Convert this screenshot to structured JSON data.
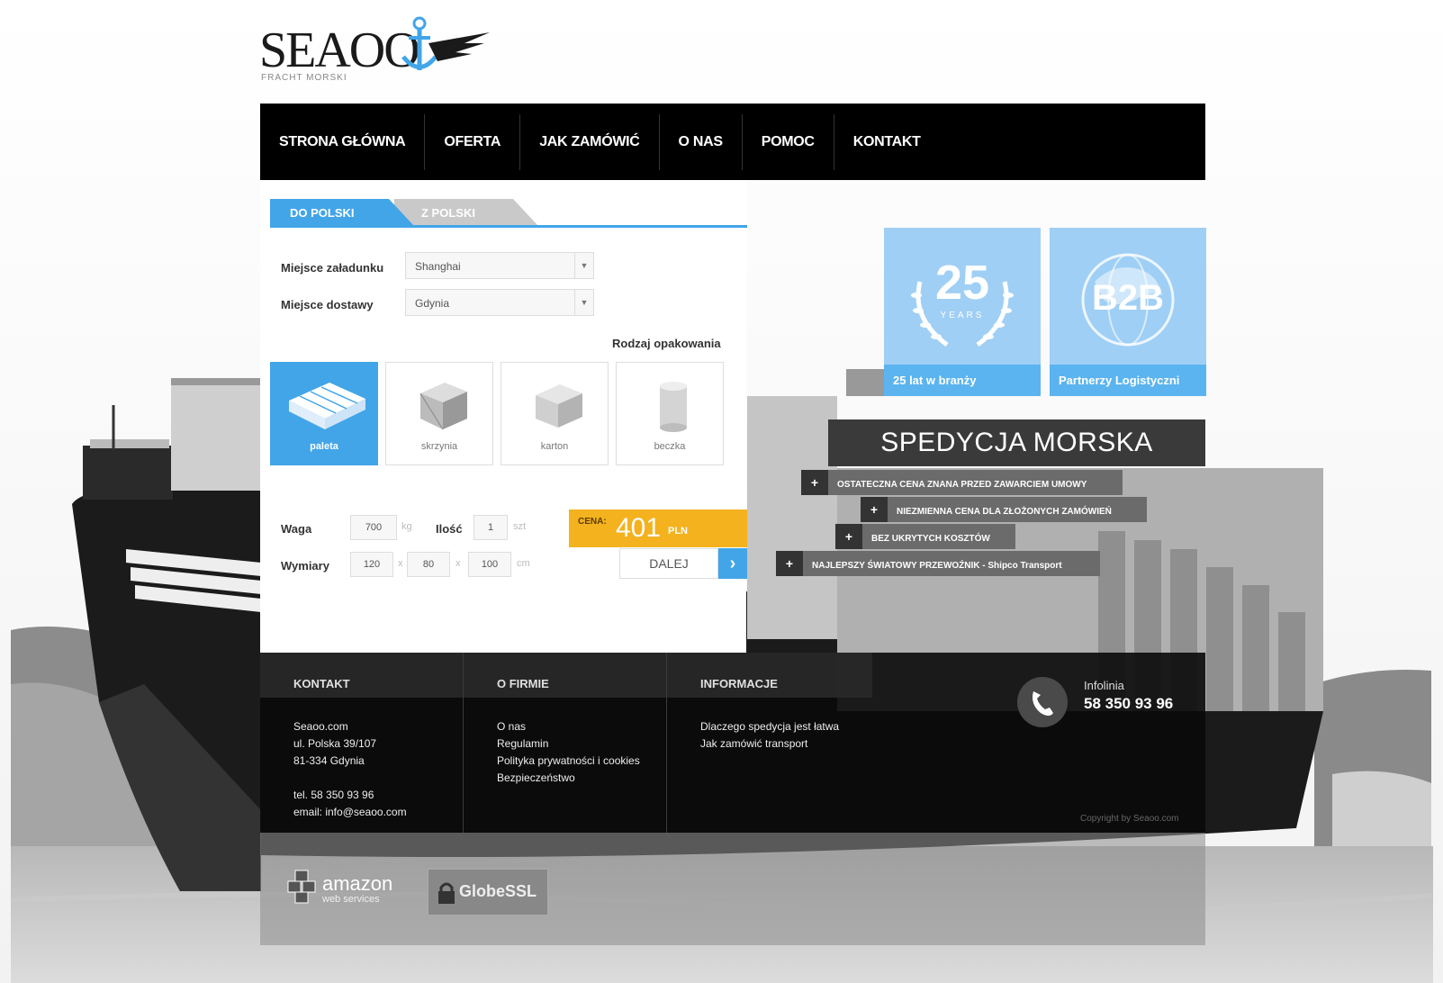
{
  "logo": {
    "text": "SEAOO",
    "subtitle": "FRACHT MORSKI"
  },
  "nav": {
    "items": [
      "STRONA GŁÓWNA",
      "OFERTA",
      "JAK ZAMÓWIĆ",
      "O NAS",
      "POMOC",
      "KONTAKT"
    ]
  },
  "tabs": {
    "active": "DO POLSKI",
    "inactive": "Z POLSKI"
  },
  "form": {
    "loading_label": "Miejsce załadunku",
    "loading_value": "Shanghai",
    "delivery_label": "Miejsce dostawy",
    "delivery_value": "Gdynia",
    "packaging_label": "Rodzaj opakowania",
    "packaging": [
      "paleta",
      "skrzynia",
      "karton",
      "beczka"
    ],
    "weight_label": "Waga",
    "weight_value": "700",
    "weight_unit": "kg",
    "qty_label": "Ilość",
    "qty_value": "1",
    "qty_unit": "szt",
    "dims_label": "Wymiary",
    "dim1": "120",
    "dim2": "80",
    "dim3": "100",
    "dim_sep": "x",
    "dims_unit": "cm"
  },
  "price": {
    "label": "CENA:",
    "value": "401",
    "currency": "PLN"
  },
  "next_button": "DALEJ",
  "badges": {
    "years": {
      "number": "25",
      "word": "YEARS",
      "caption": "25 lat w branży"
    },
    "b2b": {
      "text": "B2B",
      "caption": "Partnerzy Logistyczni"
    }
  },
  "spedycja": {
    "title": "SPEDYCJA MORSKA",
    "features": [
      "OSTATECZNA CENA ZNANA PRZED ZAWARCIEM UMOWY",
      "NIEZMIENNA CENA DLA ZŁOŻONYCH ZAMÓWIEŃ",
      "BEZ UKRYTYCH KOSZTÓW",
      "NAJLEPSZY ŚWIATOWY PRZEWOŹNIK - Shipco Transport"
    ],
    "plus": "+"
  },
  "footer": {
    "col1_title": "KONTAKT",
    "col1_lines": [
      "Seaoo.com",
      "ul. Polska 39/107",
      "81-334 Gdynia",
      "",
      "tel. 58 350 93 96",
      "email: info@seaoo.com"
    ],
    "col2_title": "O FIRMIE",
    "col2_lines": [
      "O nas",
      "Regulamin",
      "Polityka prywatności i cookies",
      "Bezpieczeństwo"
    ],
    "col3_title": "INFORMACJE",
    "col3_lines": [
      "Dlaczego spedycja jest łatwa",
      "Jak zamówić transport"
    ],
    "infolinia_label": "Infolinia",
    "infolinia_number": "58 350 93 96",
    "copyright": "Copyright by Seaoo.com"
  },
  "partners": {
    "amazon": "amazon",
    "amazon_sub": "web services",
    "globessl": "GlobeSSL"
  },
  "colors": {
    "accent": "#42a5e8",
    "price": "#f3b21e",
    "nav": "#000000"
  }
}
